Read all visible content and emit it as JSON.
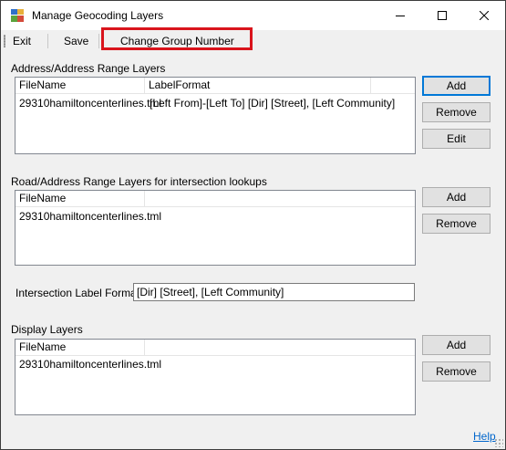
{
  "window": {
    "title": "Manage Geocoding Layers"
  },
  "menu": {
    "exit": "Exit",
    "save": "Save",
    "change_group_number": "Change Group Number"
  },
  "address_layers": {
    "label": "Address/Address Range Layers",
    "columns": [
      "FileName",
      "LabelFormat"
    ],
    "rows": [
      {
        "file": "29310hamiltoncenterlines.tml",
        "format": "[Left From]-[Left To] [Dir] [Street], [Left Community]"
      }
    ],
    "buttons": {
      "add": "Add",
      "remove": "Remove",
      "edit": "Edit"
    }
  },
  "road_layers": {
    "label": "Road/Address Range Layers for intersection lookups",
    "columns": [
      "FileName"
    ],
    "rows": [
      {
        "file": "29310hamiltoncenterlines.tml"
      }
    ],
    "buttons": {
      "add": "Add",
      "remove": "Remove"
    }
  },
  "intersection": {
    "label": "Intersection Label Format",
    "value": "[Dir] [Street], [Left Community]"
  },
  "display_layers": {
    "label": "Display Layers",
    "columns": [
      "FileName"
    ],
    "rows": [
      {
        "file": "29310hamiltoncenterlines.tml"
      }
    ],
    "buttons": {
      "add": "Add",
      "remove": "Remove"
    }
  },
  "help": {
    "label": "Help"
  },
  "colors": {
    "highlight": "#d9141c",
    "link": "#0066cc",
    "default_button_border": "#0078d7"
  }
}
